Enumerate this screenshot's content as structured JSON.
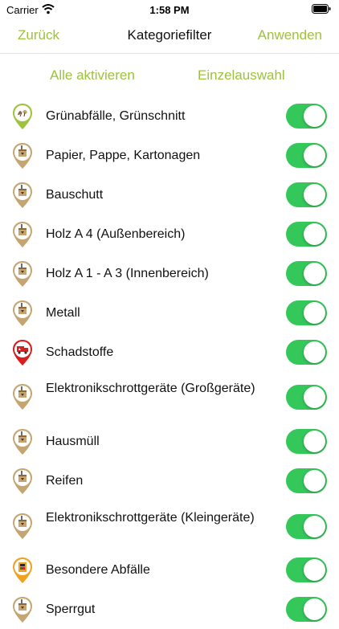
{
  "status": {
    "carrier": "Carrier",
    "time": "1:58 PM"
  },
  "nav": {
    "back": "Zurück",
    "title": "Kategoriefilter",
    "apply": "Anwenden"
  },
  "actions": {
    "all": "Alle aktivieren",
    "single": "Einzelauswahl"
  },
  "colors": {
    "accent": "#9dc23b",
    "switch_on": "#34c759"
  },
  "categories": [
    {
      "label": "Grünabfälle, Grünschnitt",
      "icon": "green-waste-pin-icon",
      "enabled": true
    },
    {
      "label": "Papier, Pappe, Kartonagen",
      "icon": "recycling-pin-icon",
      "enabled": true
    },
    {
      "label": "Bauschutt",
      "icon": "recycling-pin-icon",
      "enabled": true
    },
    {
      "label": "Holz A 4 (Außenbereich)",
      "icon": "recycling-pin-icon",
      "enabled": true
    },
    {
      "label": "Holz A 1 - A 3 (Innenbereich)",
      "icon": "recycling-pin-icon",
      "enabled": true
    },
    {
      "label": "Metall",
      "icon": "recycling-pin-icon",
      "enabled": true
    },
    {
      "label": "Schadstoffe",
      "icon": "hazardous-truck-pin-icon",
      "enabled": true
    },
    {
      "label": "Elektronikschrottgeräte (Großgeräte)",
      "icon": "recycling-pin-icon",
      "enabled": true
    },
    {
      "label": "Hausmüll",
      "icon": "recycling-pin-icon",
      "enabled": true
    },
    {
      "label": "Reifen",
      "icon": "recycling-pin-icon",
      "enabled": true
    },
    {
      "label": "Elektronikschrottgeräte (Kleingeräte)",
      "icon": "recycling-pin-icon",
      "enabled": true
    },
    {
      "label": "Besondere Abfälle",
      "icon": "special-waste-pin-icon",
      "enabled": true
    },
    {
      "label": "Sperrgut",
      "icon": "recycling-pin-icon",
      "enabled": true
    }
  ]
}
